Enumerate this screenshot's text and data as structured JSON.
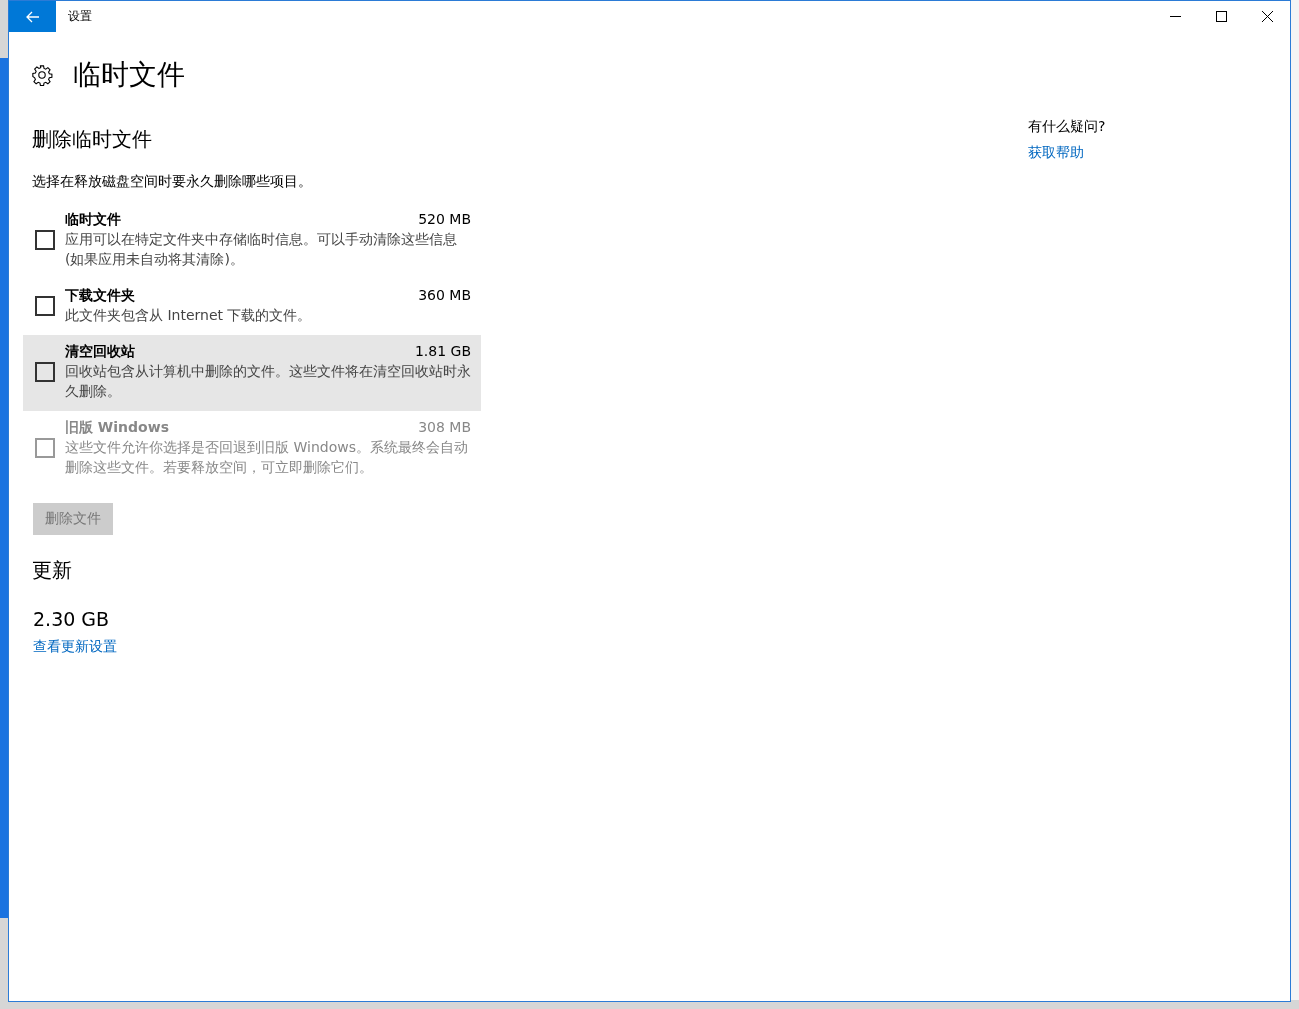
{
  "window": {
    "title": "设置"
  },
  "page_title": "临时文件",
  "section": {
    "heading": "删除临时文件",
    "intro": "选择在释放磁盘空间时要永久删除哪些项目。",
    "items": [
      {
        "title": "临时文件",
        "size": "520 MB",
        "description": "应用可以在特定文件夹中存储临时信息。可以手动清除这些信息(如果应用未自动将其清除)。",
        "checked": false,
        "disabled": false,
        "hovered": false
      },
      {
        "title": "下载文件夹",
        "size": "360 MB",
        "description": "此文件夹包含从 Internet 下载的文件。",
        "checked": false,
        "disabled": false,
        "hovered": false
      },
      {
        "title": "清空回收站",
        "size": "1.81 GB",
        "description": "回收站包含从计算机中删除的文件。这些文件将在清空回收站时永久删除。",
        "checked": false,
        "disabled": false,
        "hovered": true
      },
      {
        "title": "旧版 Windows",
        "size": "308 MB",
        "description": "这些文件允许你选择是否回退到旧版 Windows。系统最终会自动删除这些文件。若要释放空间，可立即删除它们。",
        "checked": false,
        "disabled": true,
        "hovered": false
      }
    ],
    "delete_button": {
      "label": "删除文件",
      "disabled": true
    }
  },
  "updates": {
    "heading": "更新",
    "size": "2.30 GB",
    "link": "查看更新设置"
  },
  "help": {
    "question": "有什么疑问?",
    "link": "获取帮助"
  }
}
